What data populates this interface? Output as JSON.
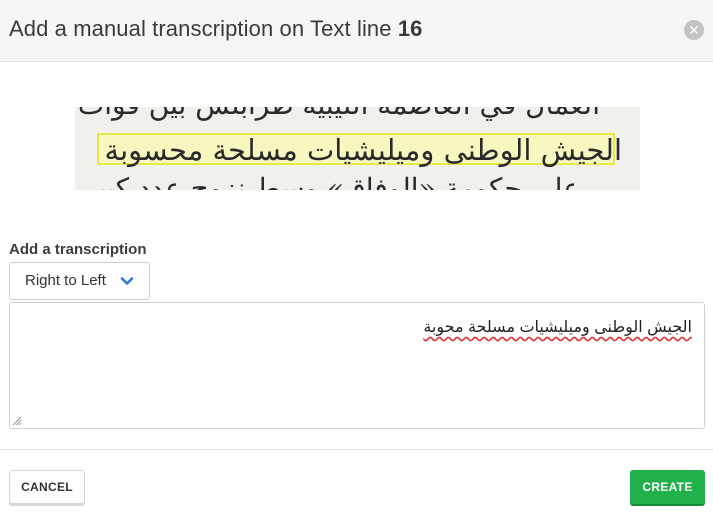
{
  "dialog": {
    "title_prefix": "Add a manual transcription on Text line",
    "line_number": "16"
  },
  "scan": {
    "line_above": "العمال في العاصمة الليبية طرابلس بين قوات",
    "line_current": "الجيش الوطنى وميليشيات مسلحة محسوبة",
    "line_below": "على حكومة «الوفاق» وسط نزوح عدد كبير",
    "highlight_color": "#e8e84a"
  },
  "form": {
    "label": "Add a transcription",
    "direction_value": "Right to Left",
    "transcription_value": "الجيش الوطنى وميليشيات مسلحة محوبة"
  },
  "actions": {
    "cancel_label": "CANCEL",
    "create_label": "CREATE",
    "create_color": "#21b04b"
  }
}
